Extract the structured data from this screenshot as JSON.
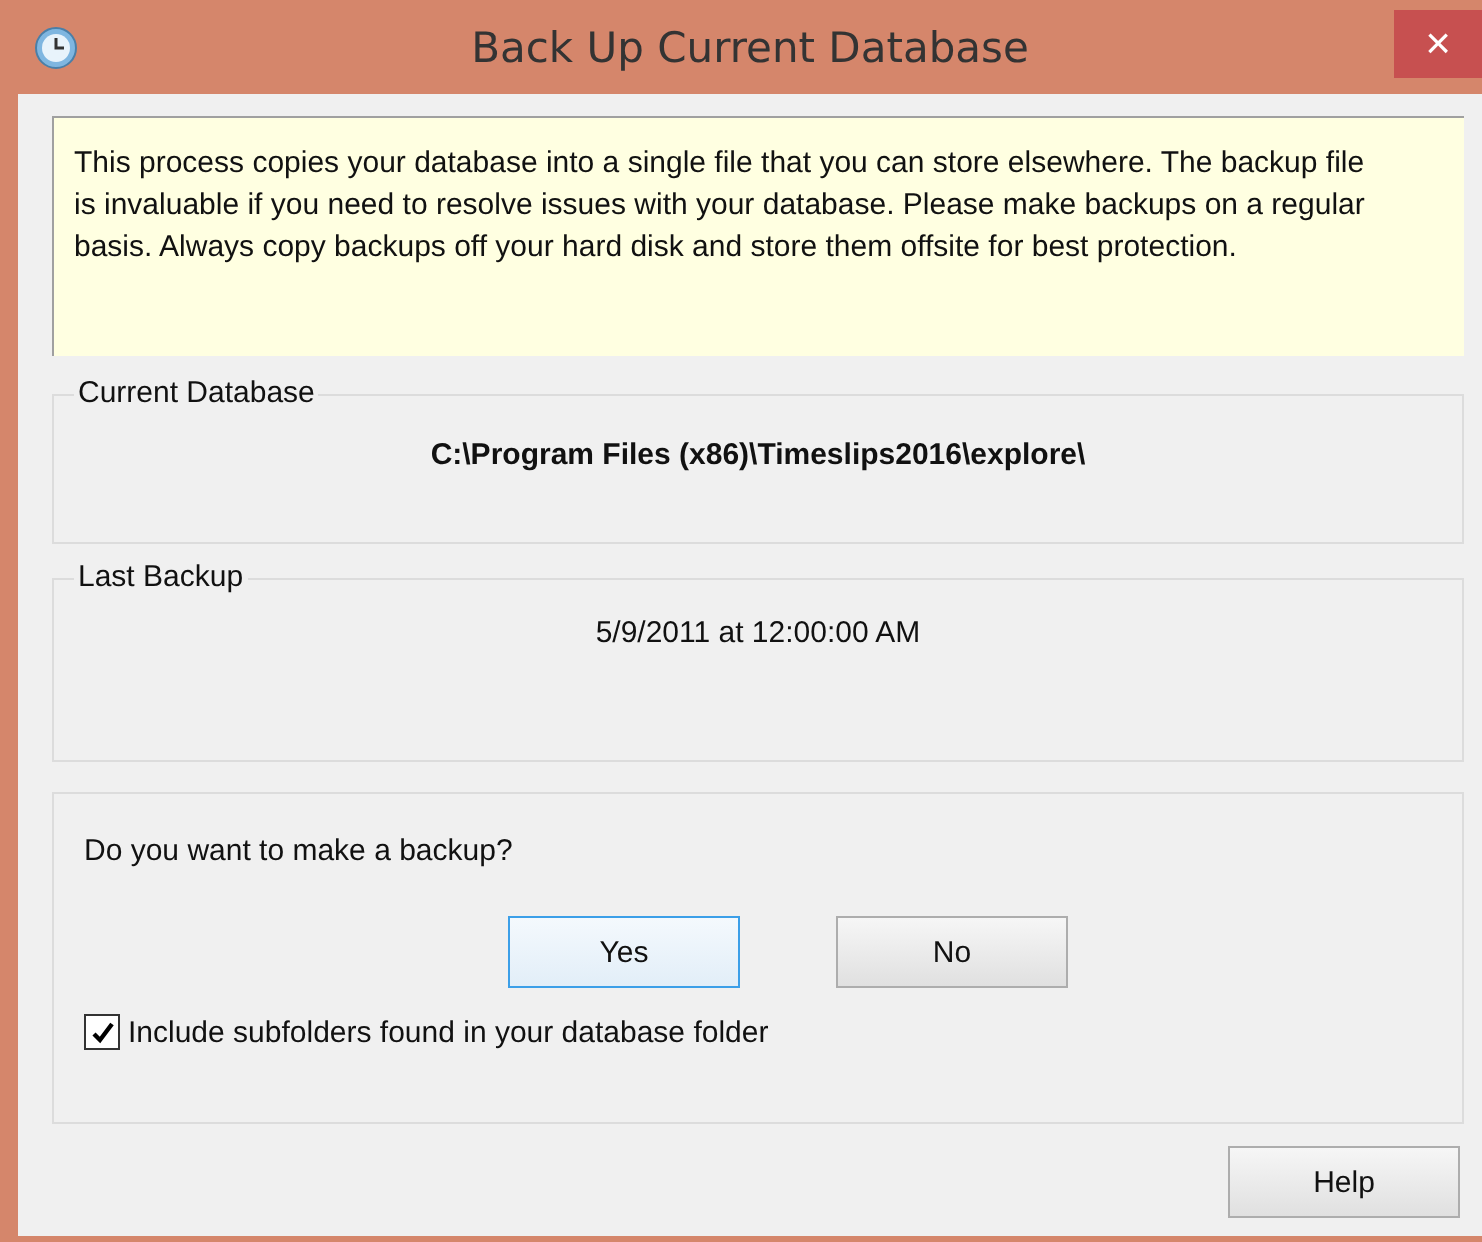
{
  "window": {
    "title": "Back Up Current Database",
    "close": "×"
  },
  "info": "This process copies your database into a single file that you can store elsewhere. The backup file is invaluable if you need to resolve issues with your database. Please make backups on a regular basis. Always copy backups off your hard disk and store them offsite for best protection.",
  "groups": [
    {
      "label": "Current Database",
      "value": "C:\\Program Files (x86)\\Timeslips2016\\explore\\",
      "bold": true
    },
    {
      "label": "Last Backup",
      "value": "5/9/2011 at 12:00:00 AM",
      "bold": false
    }
  ],
  "question": "Do you want to make a backup?",
  "buttons": [
    {
      "label": "Yes",
      "focused": true
    },
    {
      "label": "No",
      "focused": false
    }
  ],
  "checkbox": {
    "label": "Include subfolders found in your database folder",
    "checked": true
  },
  "help_button": "Help"
}
